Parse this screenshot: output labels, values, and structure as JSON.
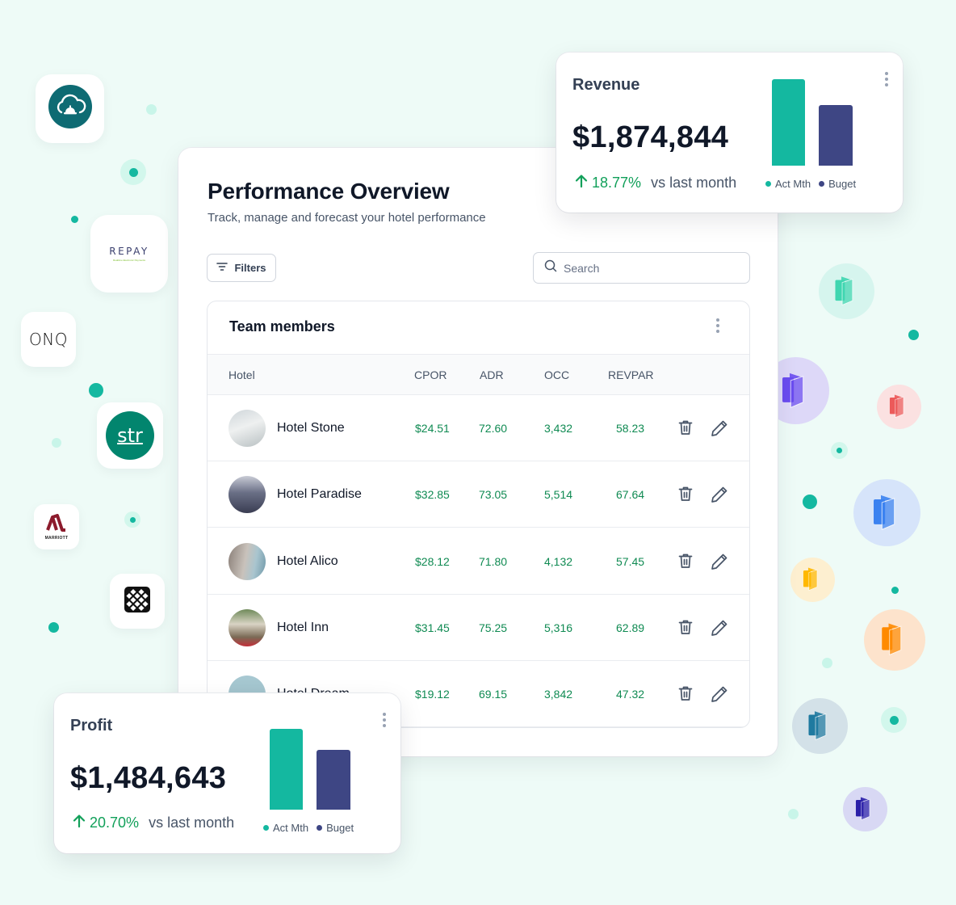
{
  "colors": {
    "background": "#eefbf7",
    "accent_teal": "#14b8a0",
    "budget_navy": "#3e4684",
    "positive_green": "#12a05a",
    "value_green": "#0f8a52"
  },
  "integrations": [
    {
      "name": "Cloud hotel bell",
      "icon": "cloud-bell-icon"
    },
    {
      "name": "REPAY",
      "tagline": "Realtime Electronic Payments",
      "icon": "repay-logo"
    },
    {
      "name": "ONQ",
      "icon": "onq-logo"
    },
    {
      "name": "str",
      "icon": "str-logo"
    },
    {
      "name": "MARRIOTT",
      "icon": "marriott-logo"
    },
    {
      "name": "Lattice",
      "icon": "lattice-logo"
    }
  ],
  "app_icons": [
    {
      "icon": "folded-brochure-icon",
      "color": "#3fd6b0",
      "bg": "#d6f5ee"
    },
    {
      "icon": "folded-brochure-icon",
      "color": "#6a4cf0",
      "bg": "#ddd8f8"
    },
    {
      "icon": "folded-brochure-icon",
      "color": "#ec5a5a",
      "bg": "#fbe1e1"
    },
    {
      "icon": "folded-brochure-icon",
      "color": "#3b82f0",
      "bg": "#d6e4fa"
    },
    {
      "icon": "folded-brochure-icon",
      "color": "#ffb800",
      "bg": "#fdefd0"
    },
    {
      "icon": "folded-brochure-icon",
      "color": "#ff8a00",
      "bg": "#fde3cc"
    },
    {
      "icon": "folded-brochure-icon",
      "color": "#1f7aa0",
      "bg": "#d3e1e8"
    },
    {
      "icon": "folded-brochure-icon",
      "color": "#2a1fa8",
      "bg": "#d8d8f4"
    }
  ],
  "overview": {
    "title": "Performance Overview",
    "subtitle": "Track, manage and forecast your hotel performance",
    "filters_label": "Filters",
    "search_placeholder": "Search",
    "search_value": ""
  },
  "table": {
    "title": "Team members",
    "columns": [
      "Hotel",
      "CPOR",
      "ADR",
      "OCC",
      "REVPAR"
    ],
    "rows": [
      {
        "hotel": "Hotel Stone",
        "cpor": "$24.51",
        "adr": "72.60",
        "occ": "3,432",
        "revpar": "58.23"
      },
      {
        "hotel": "Hotel Paradise",
        "cpor": "$32.85",
        "adr": "73.05",
        "occ": "5,514",
        "revpar": "67.64"
      },
      {
        "hotel": "Hotel Alico",
        "cpor": "$28.12",
        "adr": "71.80",
        "occ": "4,132",
        "revpar": "57.45"
      },
      {
        "hotel": "Hotel Inn",
        "cpor": "$31.45",
        "adr": "75.25",
        "occ": "5,316",
        "revpar": "62.89"
      },
      {
        "hotel": "Hotel Dream",
        "cpor": "$19.12",
        "adr": "69.15",
        "occ": "3,842",
        "revpar": "47.32"
      }
    ]
  },
  "revenue": {
    "title": "Revenue",
    "value": "$1,874,844",
    "change": "18.77%",
    "change_suffix": "vs last month",
    "legend": [
      "Act Mth",
      "Buget"
    ],
    "bars": {
      "act_mth": 1.0,
      "budget": 0.7
    }
  },
  "profit": {
    "title": "Profit",
    "value": "$1,484,643",
    "change": "20.70%",
    "change_suffix": "vs last month",
    "legend": [
      "Act Mth",
      "Buget"
    ],
    "bars": {
      "act_mth": 1.0,
      "budget": 0.74
    }
  }
}
